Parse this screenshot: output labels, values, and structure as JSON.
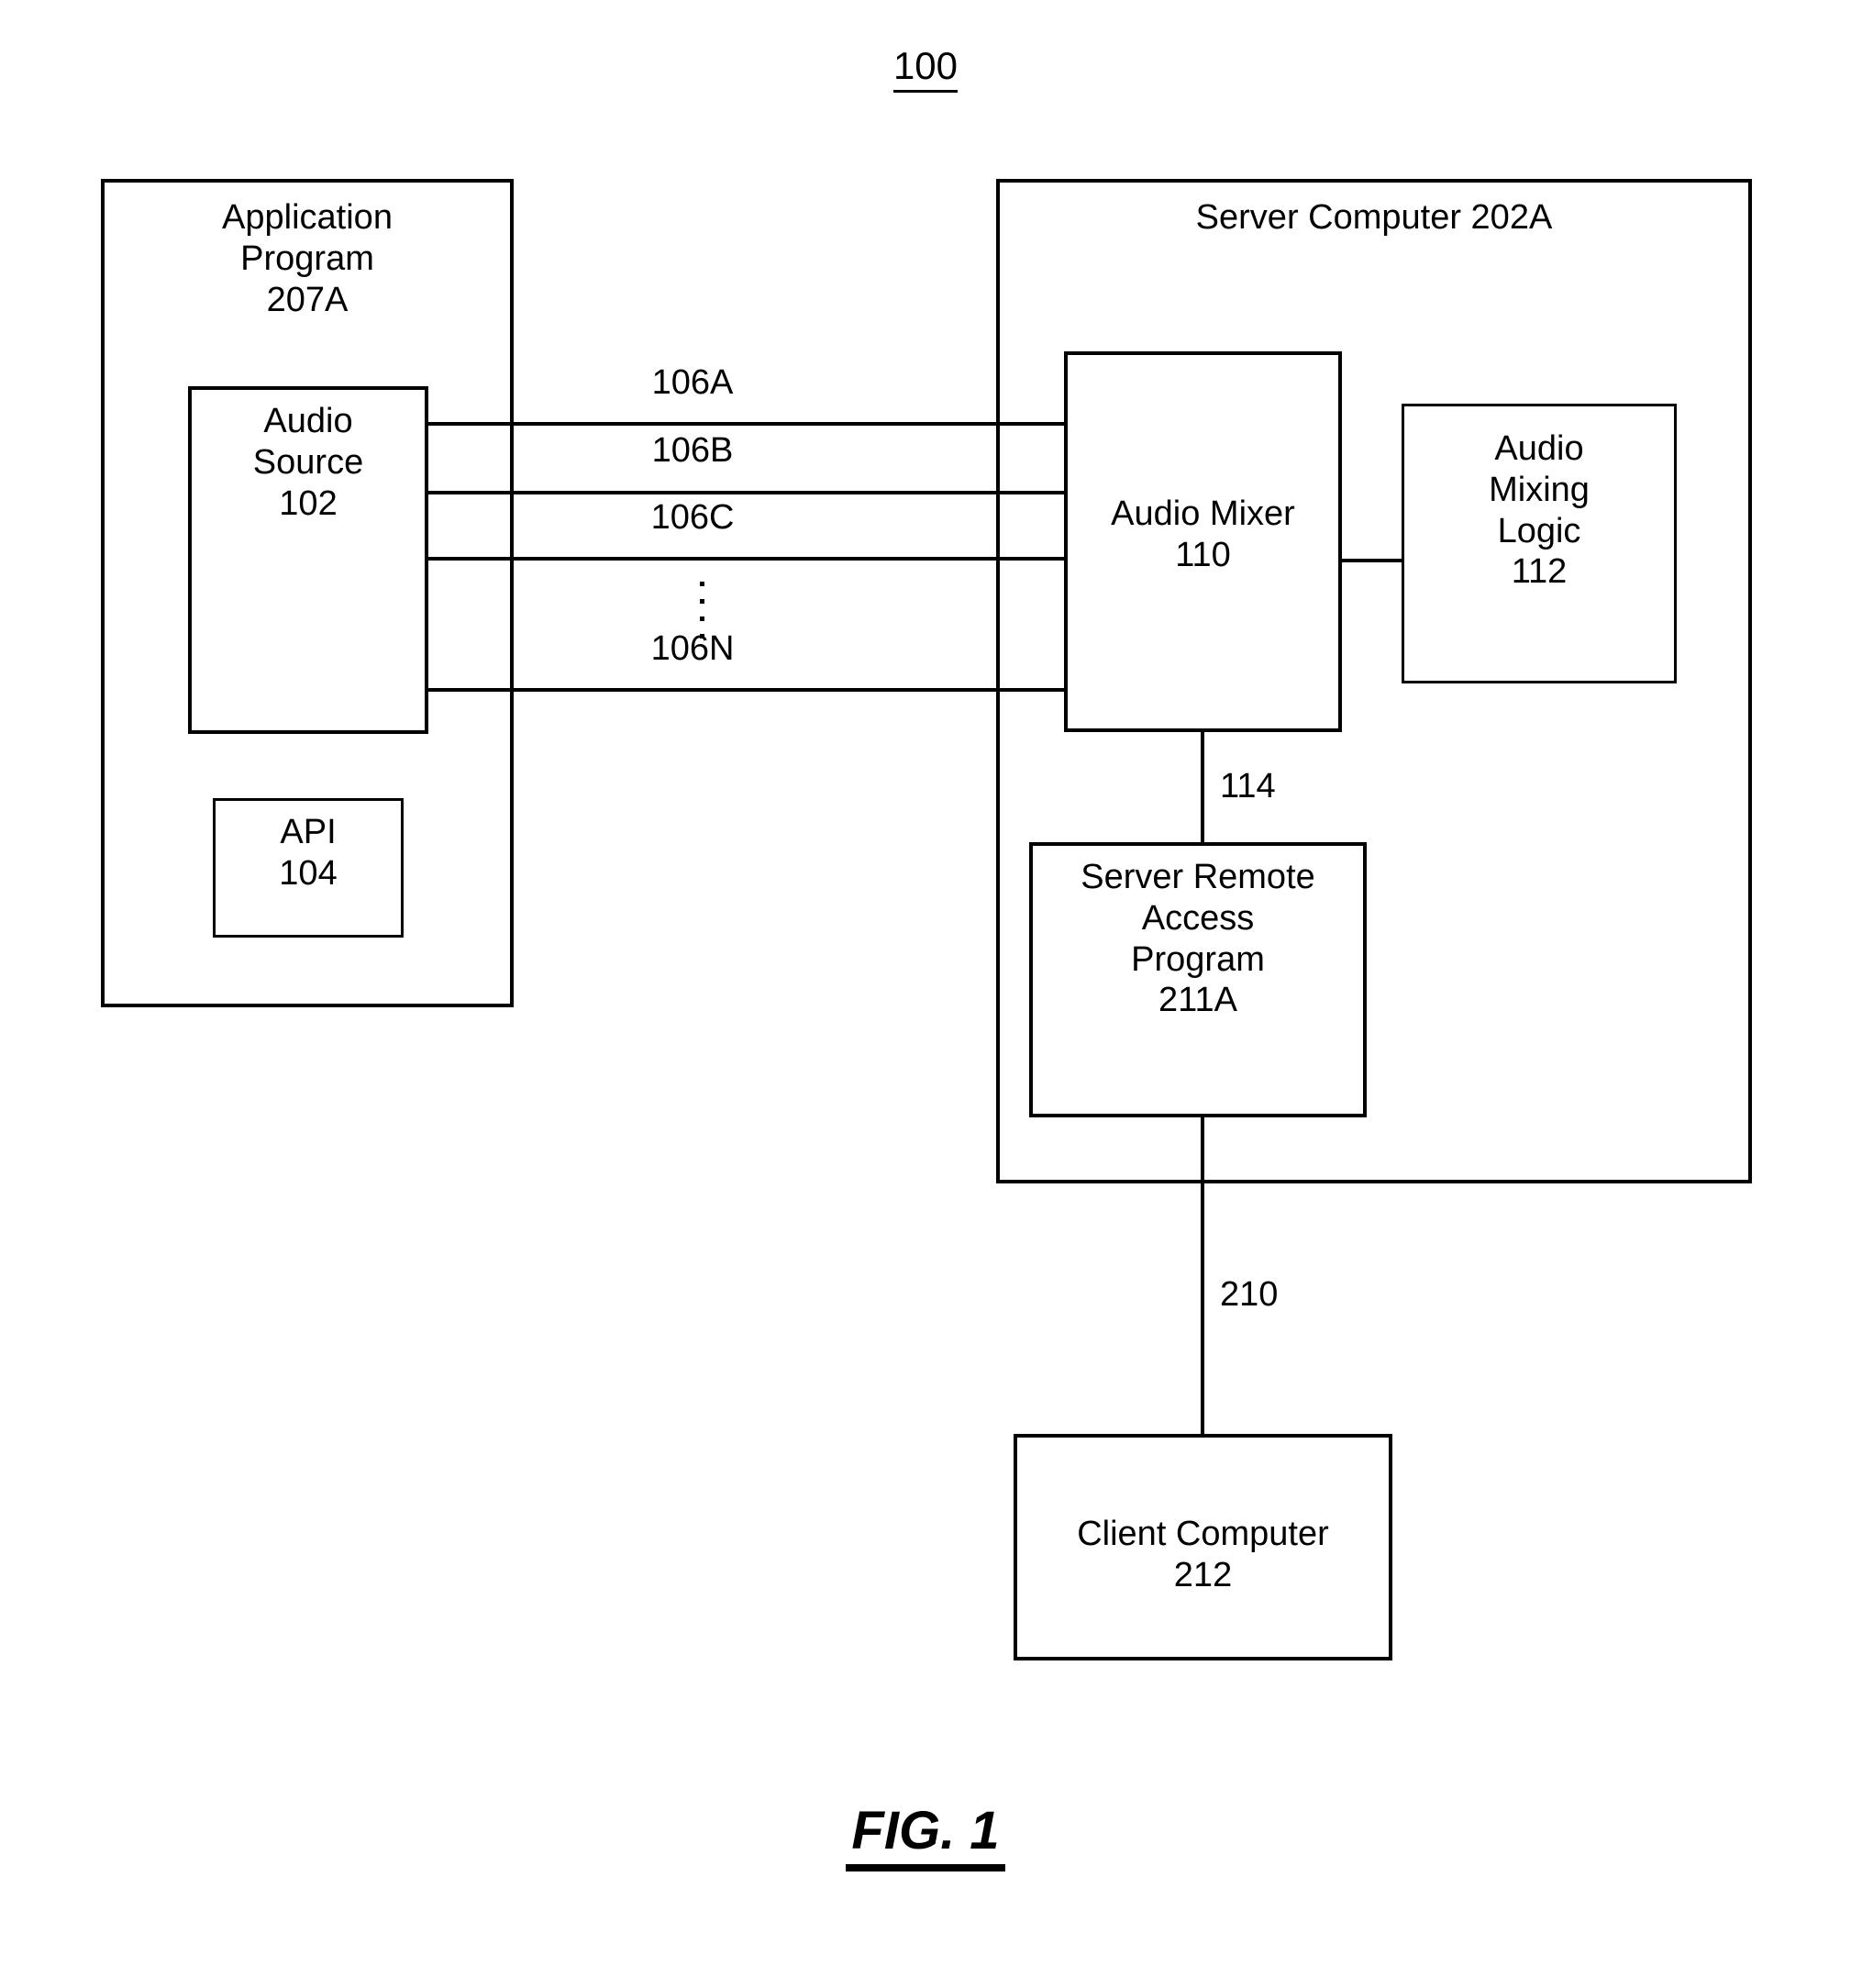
{
  "figure": {
    "number": "100",
    "caption": "FIG. 1"
  },
  "blocks": {
    "application_program": {
      "title": "Application\nProgram\n207A",
      "name": "Application Program",
      "ref": "207A"
    },
    "audio_source": {
      "title": "Audio\nSource\n102",
      "name": "Audio Source",
      "ref": "102"
    },
    "api": {
      "title": "API\n104",
      "name": "API",
      "ref": "104"
    },
    "server_computer": {
      "title": "Server Computer 202A",
      "name": "Server Computer",
      "ref": "202A"
    },
    "audio_mixer": {
      "title": "Audio Mixer\n110",
      "name": "Audio Mixer",
      "ref": "110"
    },
    "audio_mixing_logic": {
      "title": "Audio\nMixing\nLogic\n112",
      "name": "Audio Mixing Logic",
      "ref": "112"
    },
    "server_remote_access_program": {
      "title": "Server Remote\nAccess\nProgram\n211A",
      "name": "Server Remote Access Program",
      "ref": "211A"
    },
    "client_computer": {
      "title": "Client Computer\n212",
      "name": "Client Computer",
      "ref": "212"
    }
  },
  "connections": {
    "channel_a": "106A",
    "channel_b": "106B",
    "channel_c": "106C",
    "channel_n": "106N",
    "mixer_to_remote_access": "114",
    "remote_access_to_client": "210"
  },
  "colors": {
    "stroke": "#000000",
    "background": "#ffffff"
  }
}
